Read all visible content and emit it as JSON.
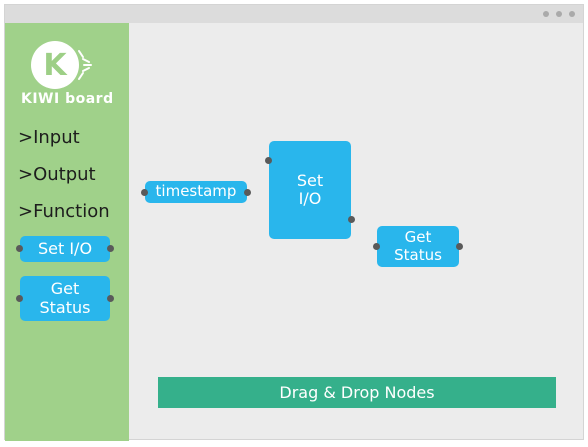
{
  "brand": {
    "logo_letter": "K",
    "name": "KIWI board",
    "colors": {
      "sidebar": "#a0d18a",
      "node": "#29b6ec",
      "banner": "#35b08b",
      "canvas": "#ececec"
    }
  },
  "sidebar": {
    "categories": [
      ">Input",
      ">Output",
      ">Function"
    ],
    "palette_nodes": [
      {
        "label": "Set I/O"
      },
      {
        "label_line1": "Get",
        "label_line2": "Status"
      }
    ]
  },
  "canvas": {
    "nodes": {
      "timestamp": {
        "label": "timestamp"
      },
      "set_io": {
        "label_line1": "Set",
        "label_line2": "I/O"
      },
      "get_status": {
        "label_line1": "Get",
        "label_line2": "Status"
      }
    },
    "banner": "Drag & Drop Nodes"
  }
}
